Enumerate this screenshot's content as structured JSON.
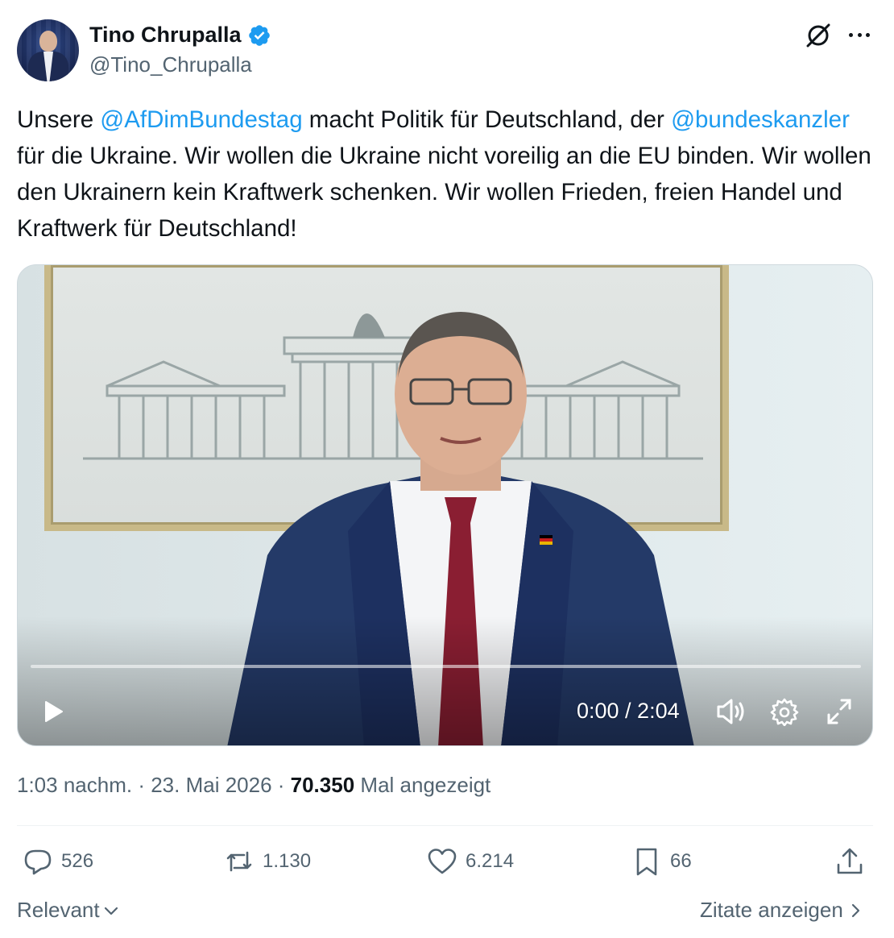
{
  "author": {
    "display_name": "Tino Chrupalla",
    "handle": "@Tino_Chrupalla",
    "verified": true
  },
  "tweet": {
    "text_part1": "Unsere ",
    "mention1": "@AfDimBundestag",
    "text_part2": " macht Politik für Deutschland, der ",
    "mention2": "@bundeskanzler",
    "text_part3": " für die Ukraine. Wir wollen die Ukraine nicht voreilig an die EU binden. Wir wollen den Ukrainern kein Kraftwerk schenken. Wir wollen Frieden, freien Handel und Kraftwerk für Deutschland!"
  },
  "video": {
    "time": "0:00 / 2:04",
    "progress": 0.0
  },
  "meta": {
    "time": "1:03 nachm.",
    "sep": " · ",
    "date": "23. Mai 2026",
    "views": "70.350",
    "views_label": "Mal angezeigt"
  },
  "actions": {
    "replies": "526",
    "retweets": "1.130",
    "likes": "6.214",
    "bookmarks": "66"
  },
  "footer": {
    "sort_label": "Relevant",
    "quotes_label": "Zitate anzeigen"
  },
  "colors": {
    "accent": "#1d9bf0",
    "text": "#0f1419",
    "muted": "#536471"
  },
  "icons": [
    "verified-icon",
    "grok-icon",
    "more-icon",
    "play-icon",
    "volume-icon",
    "settings-icon",
    "fullscreen-icon",
    "reply-icon",
    "retweet-icon",
    "like-icon",
    "bookmark-icon",
    "share-icon",
    "chevron-down-icon",
    "chevron-right-icon"
  ]
}
